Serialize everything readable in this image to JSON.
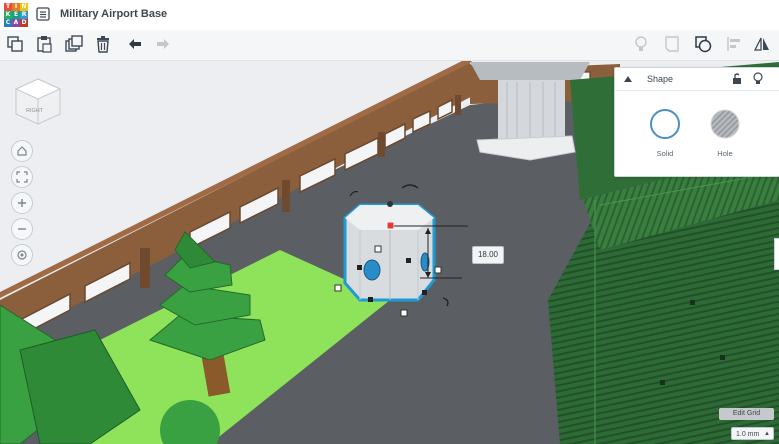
{
  "app": {
    "logo_letters": [
      "T",
      "I",
      "N",
      "K",
      "E",
      "R",
      "C",
      "A",
      "D"
    ],
    "logo_colors": [
      "#e74c3c",
      "#e67e22",
      "#f1c40f",
      "#27ae60",
      "#16a085",
      "#3498db",
      "#2980b9",
      "#8e44ad",
      "#c0392b"
    ],
    "title": "Military Airport Base"
  },
  "toolbar": {
    "left_icons": [
      "copy-icon",
      "paste-icon",
      "duplicate-icon",
      "trash-icon",
      "undo-icon",
      "redo-icon"
    ],
    "right_icons": [
      "light-bulb-icon",
      "note-icon",
      "group-icon",
      "align-icon",
      "mirror-icon"
    ]
  },
  "viewcube": {
    "face_label": "RIGHT"
  },
  "shape_panel": {
    "title": "Shape",
    "solid_label": "Solid",
    "hole_label": "Hole"
  },
  "dimension": {
    "value": "18.00"
  },
  "edit_grid": {
    "label": "Edit Grid"
  },
  "snap_grid": {
    "value": "1.0 mm"
  },
  "colors": {
    "workplane": "#5b5e62",
    "wall": "#8b5e3c",
    "wall_light": "#f4f5f6",
    "tree_green": "#3aa142",
    "grass": "#8fe35b",
    "hangar_green": "#2d6a35",
    "selection": "#1e9ad6"
  }
}
